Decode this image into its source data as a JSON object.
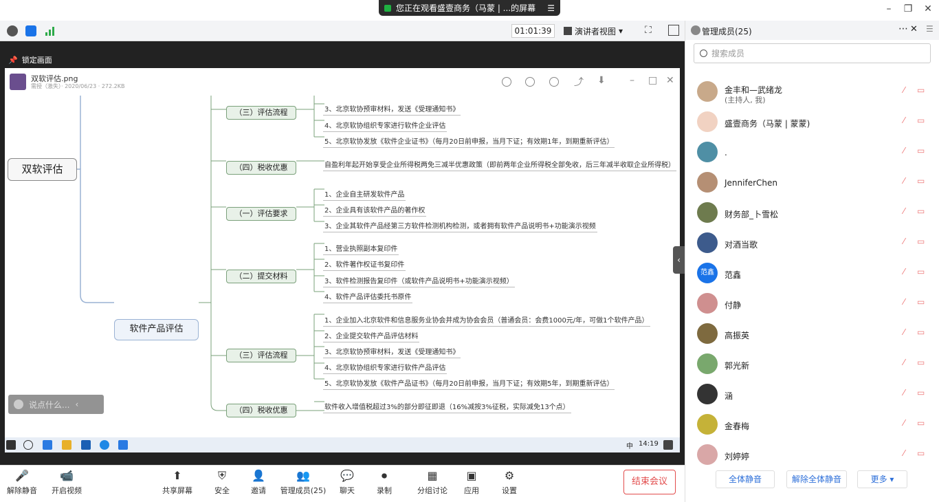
{
  "banner": {
    "text": "您正在观看盛壹商务（马蒙 | ...的屏幕"
  },
  "window": {
    "minimize": "–",
    "restore": "❐",
    "close": "✕"
  },
  "topbar": {
    "timer": "01:01:39",
    "view": "演讲者视图"
  },
  "lock": {
    "label": "锁定画面"
  },
  "viewer": {
    "file_name": "双软评估.png",
    "file_meta": "需授（激失）· 2020/06/23 · 272.2KB"
  },
  "mindmap": {
    "root": "双软评估",
    "mid": "软件产品评估",
    "nodes": [
      {
        "id": "n1",
        "label": "（三）评估流程"
      },
      {
        "id": "n2",
        "label": "（四）税收优惠"
      },
      {
        "id": "n3",
        "label": "（一）评估要求"
      },
      {
        "id": "n4",
        "label": "（二）提交材料"
      },
      {
        "id": "n5",
        "label": "（三）评估流程"
      },
      {
        "id": "n6",
        "label": "（四）税收优惠"
      }
    ],
    "leaves": [
      "3、北京软协预审材料，发送《受理通知书》",
      "4、北京软协组织专家进行软件企业评估",
      "5、北京软协发放《软件企业证书》（每月20日前申报，当月下证；有效期1年，到期重新评估）",
      "自盈利年起开始享受企业所得税两免三减半优惠政策（即前两年企业所得税全部免收，后三年减半收取企业所得税）",
      "1、企业自主研发软件产品",
      "2、企业具有该软件产品的著作权",
      "3、企业其软件产品经第三方软件检测机构检测，或者拥有软件产品说明书+功能演示视频",
      "1、营业执照副本复印件",
      "2、软件著作权证书复印件",
      "3、软件检测报告复印件（或软件产品说明书+功能演示视频）",
      "4、软件产品评估委托书原件",
      "1、企业加入北京软件和信息服务业协会并成为协会会员（普通会员：会费1000元/年，可做1个软件产品）",
      "2、企业提交软件产品评估材料",
      "3、北京软协预审材料，发送《受理通知书》",
      "4、北京软协组织专家进行软件产品评估",
      "5、北京软协发放《软件产品证书》（每月20日前申报，当月下证；有效期5年，到期重新评估）",
      "软件收入增值税超过3%的部分即征即退（16%减按3%征税，实际减免13个点）"
    ]
  },
  "chat": {
    "placeholder": "说点什么..."
  },
  "taskbar": {
    "ime": "中",
    "clock": "14:19"
  },
  "toolbar": {
    "mute": "解除静音",
    "video": "开启视频",
    "share": "共享屏幕",
    "security": "安全",
    "invite": "邀请",
    "members": "管理成员(25)",
    "chat": "聊天",
    "record": "录制",
    "breakout": "分组讨论",
    "apps": "应用",
    "settings": "设置",
    "end": "结束会议"
  },
  "panel": {
    "title": "管理成员(25)",
    "search_placeholder": "搜索成员",
    "members": [
      {
        "name": "金丰和—武绪龙",
        "sub": "(主持人, 我)",
        "color": "#c8a98a"
      },
      {
        "name": "盛壹商务（马蒙 | 蒙蒙)",
        "sub": "",
        "color": "#f1d2c2"
      },
      {
        "name": ".",
        "sub": "",
        "color": "#4f8fa5"
      },
      {
        "name": "JenniferChen",
        "sub": "",
        "color": "#b58f74"
      },
      {
        "name": "财务部_卜雪松",
        "sub": "",
        "color": "#6e7b4e"
      },
      {
        "name": "对酒当歌",
        "sub": "",
        "color": "#3d5b8c"
      },
      {
        "name": "范鑫",
        "sub": "",
        "color": "#1a73e8",
        "initials": "范鑫"
      },
      {
        "name": "付静",
        "sub": "",
        "color": "#cf8f8f"
      },
      {
        "name": "高振英",
        "sub": "",
        "color": "#7e6a3f"
      },
      {
        "name": "郭光新",
        "sub": "",
        "color": "#79a86d"
      },
      {
        "name": "涵",
        "sub": "",
        "color": "#333333"
      },
      {
        "name": "金春梅",
        "sub": "",
        "color": "#c5b238"
      },
      {
        "name": "刘婷婷",
        "sub": "",
        "color": "#d9a7a7"
      }
    ],
    "mute_all": "全体静音",
    "unmute_all": "解除全体静音",
    "more": "更多 ▾"
  }
}
